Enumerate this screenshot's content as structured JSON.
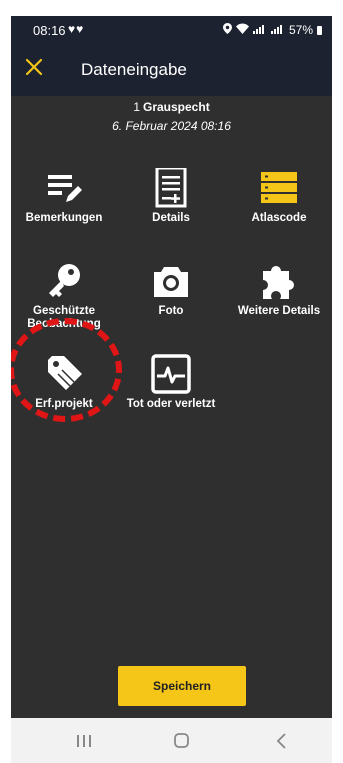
{
  "statusbar": {
    "time": "08:16",
    "hearts": "♥♥",
    "battery": "57%"
  },
  "appbar": {
    "title": "Dateneingabe",
    "close_icon": "close-icon",
    "accent_color": "#f5c518"
  },
  "record": {
    "count": "1",
    "species": "Grauspecht",
    "datetime": "6. Februar 2024 08:16"
  },
  "tiles": [
    {
      "label": "Bemerkungen",
      "icon": "notes-edit-icon"
    },
    {
      "label": "Details",
      "icon": "document-add-icon"
    },
    {
      "label": "Atlascode",
      "icon": "atlas-code-icon"
    },
    {
      "label": "Geschützte Beobachtung",
      "icon": "key-icon"
    },
    {
      "label": "Foto",
      "icon": "camera-icon"
    },
    {
      "label": "Weitere Details",
      "icon": "puzzle-icon"
    },
    {
      "label": "Erf.projekt",
      "icon": "tag-icon"
    },
    {
      "label": "Tot oder verletzt",
      "icon": "heartbeat-icon"
    }
  ],
  "save_button": {
    "label": "Speichern"
  },
  "navbar": {
    "items": [
      "recent-apps-icon",
      "home-icon",
      "back-icon"
    ]
  }
}
